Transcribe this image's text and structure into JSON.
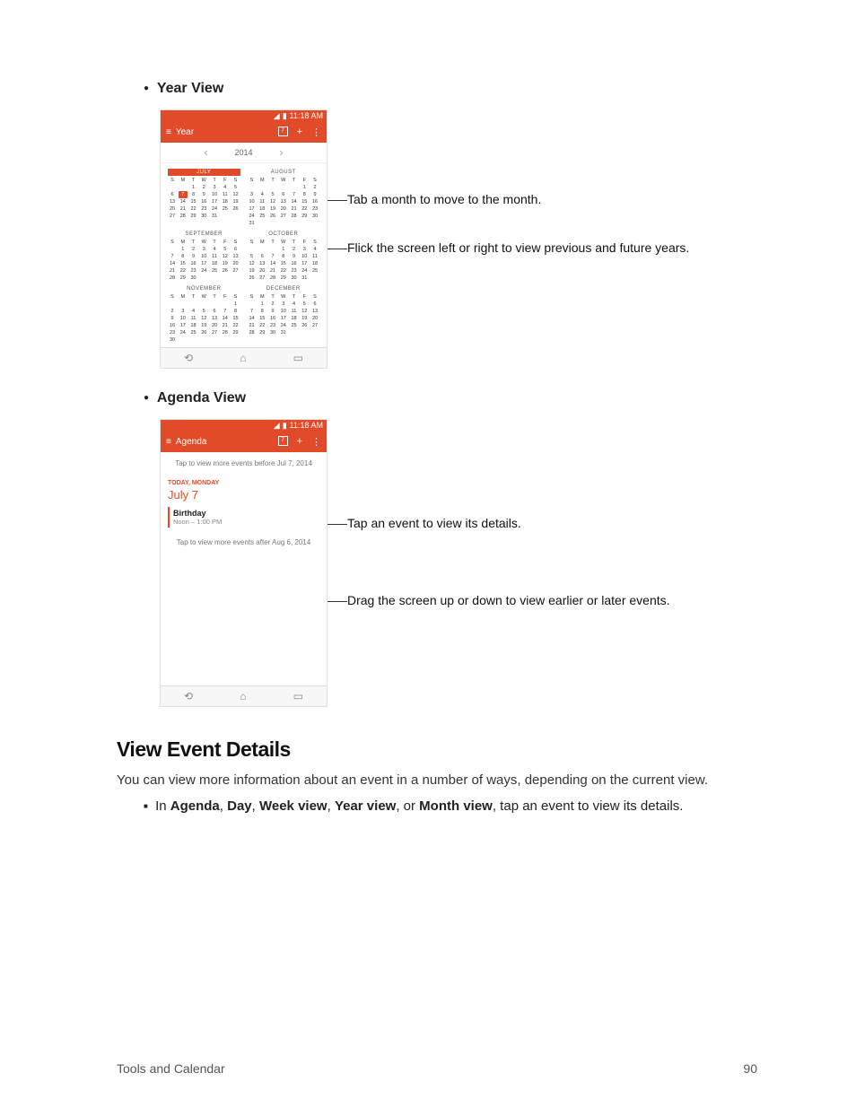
{
  "sections": {
    "year_view_label": "Year View",
    "agenda_view_label": "Agenda View"
  },
  "status_bar": {
    "time": "11:18 AM"
  },
  "year_screen": {
    "title": "Year",
    "year": "2014",
    "callout_month": "Tab a month to move to the month.",
    "callout_flick": "Flick the screen left or right to view previous and future years.",
    "dow": [
      "S",
      "M",
      "T",
      "W",
      "T",
      "F",
      "S"
    ],
    "months": [
      {
        "name": "JULY",
        "current": true,
        "today": 7,
        "weeks": [
          [
            "",
            "",
            "1",
            "2",
            "3",
            "4",
            "5"
          ],
          [
            "6",
            "7",
            "8",
            "9",
            "10",
            "11",
            "12"
          ],
          [
            "13",
            "14",
            "15",
            "16",
            "17",
            "18",
            "19"
          ],
          [
            "20",
            "21",
            "22",
            "23",
            "24",
            "25",
            "26"
          ],
          [
            "27",
            "28",
            "29",
            "30",
            "31",
            "",
            ""
          ]
        ]
      },
      {
        "name": "AUGUST",
        "weeks": [
          [
            "",
            "",
            "",
            "",
            "",
            "1",
            "2"
          ],
          [
            "3",
            "4",
            "5",
            "6",
            "7",
            "8",
            "9"
          ],
          [
            "10",
            "11",
            "12",
            "13",
            "14",
            "15",
            "16"
          ],
          [
            "17",
            "18",
            "19",
            "20",
            "21",
            "22",
            "23"
          ],
          [
            "24",
            "25",
            "26",
            "27",
            "28",
            "29",
            "30"
          ],
          [
            "31",
            "",
            "",
            "",
            "",
            "",
            ""
          ]
        ]
      },
      {
        "name": "SEPTEMBER",
        "weeks": [
          [
            "",
            "1",
            "2",
            "3",
            "4",
            "5",
            "6"
          ],
          [
            "7",
            "8",
            "9",
            "10",
            "11",
            "12",
            "13"
          ],
          [
            "14",
            "15",
            "16",
            "17",
            "18",
            "19",
            "20"
          ],
          [
            "21",
            "22",
            "23",
            "24",
            "25",
            "26",
            "27"
          ],
          [
            "28",
            "29",
            "30",
            "",
            "",
            "",
            ""
          ]
        ]
      },
      {
        "name": "OCTOBER",
        "weeks": [
          [
            "",
            "",
            "",
            "1",
            "2",
            "3",
            "4"
          ],
          [
            "5",
            "6",
            "7",
            "8",
            "9",
            "10",
            "11"
          ],
          [
            "12",
            "13",
            "14",
            "15",
            "16",
            "17",
            "18"
          ],
          [
            "19",
            "20",
            "21",
            "22",
            "23",
            "24",
            "25"
          ],
          [
            "26",
            "27",
            "28",
            "29",
            "30",
            "31",
            ""
          ]
        ]
      },
      {
        "name": "NOVEMBER",
        "weeks": [
          [
            "",
            "",
            "",
            "",
            "",
            "",
            "1"
          ],
          [
            "2",
            "3",
            "4",
            "5",
            "6",
            "7",
            "8"
          ],
          [
            "9",
            "10",
            "11",
            "12",
            "13",
            "14",
            "15"
          ],
          [
            "16",
            "17",
            "18",
            "19",
            "20",
            "21",
            "22"
          ],
          [
            "23",
            "24",
            "25",
            "26",
            "27",
            "28",
            "29"
          ],
          [
            "30",
            "",
            "",
            "",
            "",
            "",
            ""
          ]
        ]
      },
      {
        "name": "DECEMBER",
        "weeks": [
          [
            "",
            "1",
            "2",
            "3",
            "4",
            "5",
            "6"
          ],
          [
            "7",
            "8",
            "9",
            "10",
            "11",
            "12",
            "13"
          ],
          [
            "14",
            "15",
            "16",
            "17",
            "18",
            "19",
            "20"
          ],
          [
            "21",
            "22",
            "23",
            "24",
            "25",
            "26",
            "27"
          ],
          [
            "28",
            "29",
            "30",
            "31",
            "",
            "",
            ""
          ]
        ]
      }
    ]
  },
  "agenda_screen": {
    "title": "Agenda",
    "more_before": "Tap to view more events before Jul 7, 2014",
    "day_label": "TODAY, MONDAY",
    "day_date": "July 7",
    "event_title": "Birthday",
    "event_time": "Noon – 1:00 PM",
    "more_after": "Tap to view more events after Aug 6, 2014",
    "callout_tap": "Tap an event to view its details.",
    "callout_drag": "Drag the screen up or down to view earlier or later events."
  },
  "details": {
    "heading": "View Event Details",
    "intro": "You can view more information about an event in a number of ways, depending on the current view.",
    "bullet_prefix": "In ",
    "bold1": "Agenda",
    "sep": ", ",
    "bold2": "Day",
    "bold3": "Week view",
    "bold4": "Year view",
    "or": ", or ",
    "bold5": "Month view",
    "bullet_suffix": ", tap an event to view its details."
  },
  "footer": {
    "left": "Tools and Calendar",
    "right": "90"
  },
  "calendar_icon_day": "7"
}
